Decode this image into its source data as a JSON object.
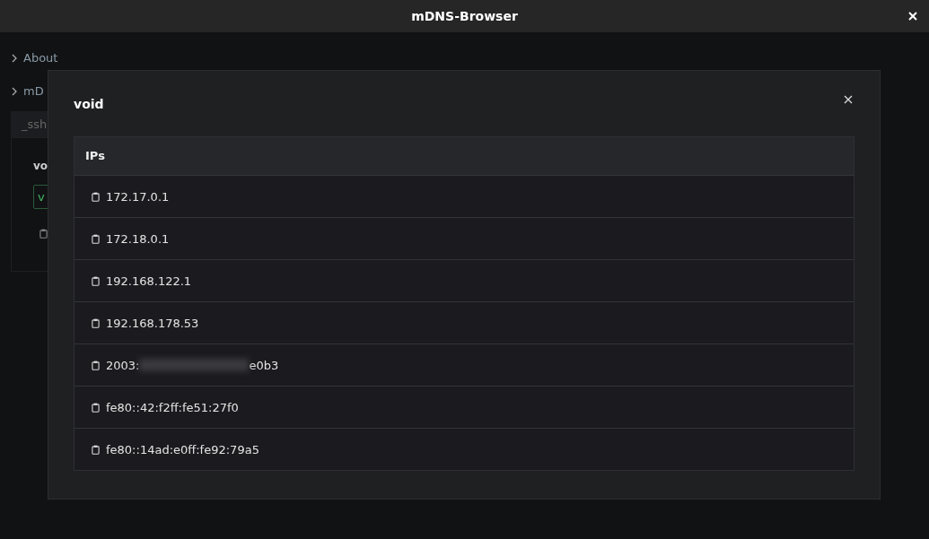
{
  "window": {
    "title": "mDNS-Browser"
  },
  "sidebar": {
    "sections": [
      {
        "label": "About",
        "expanded": false
      },
      {
        "label": "mD",
        "expanded": false
      }
    ],
    "service_tab": "_ssh",
    "card": {
      "host": "vo",
      "tag": "v"
    }
  },
  "dialog": {
    "title": "void",
    "table": {
      "header": "IPs",
      "rows": [
        {
          "kind": "plain",
          "text": "172.17.0.1"
        },
        {
          "kind": "plain",
          "text": "172.18.0.1"
        },
        {
          "kind": "plain",
          "text": "192.168.122.1"
        },
        {
          "kind": "plain",
          "text": "192.168.178.53"
        },
        {
          "kind": "redacted",
          "prefix": "2003:",
          "suffix": "e0b3"
        },
        {
          "kind": "plain",
          "text": "fe80::42:f2ff:fe51:27f0"
        },
        {
          "kind": "plain",
          "text": "fe80::14ad:e0ff:fe92:79a5"
        }
      ]
    }
  }
}
